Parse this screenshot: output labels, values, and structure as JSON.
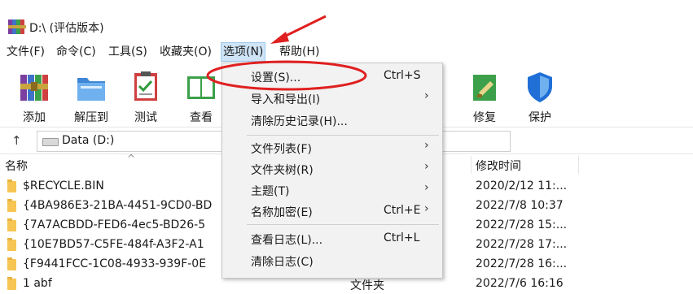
{
  "window": {
    "title": "D:\\ (评估版本)"
  },
  "menubar": {
    "items": [
      "文件(F)",
      "命令(C)",
      "工具(S)",
      "收藏夹(O)",
      "选项(N)",
      "帮助(H)"
    ],
    "active_index": 4
  },
  "toolbar": {
    "buttons": [
      {
        "label": "添加",
        "icon": "add-archive-icon"
      },
      {
        "label": "解压到",
        "icon": "extract-icon"
      },
      {
        "label": "测试",
        "icon": "test-icon"
      },
      {
        "label": "查看",
        "icon": "view-icon"
      },
      {
        "label": "修复",
        "icon": "repair-icon"
      },
      {
        "label": "保护",
        "icon": "protect-shield-icon"
      }
    ]
  },
  "address": {
    "up_glyph": "↑",
    "path": "Data (D:)"
  },
  "columns": {
    "name": "名称",
    "sort_glyph": "^",
    "modified": "修改时间"
  },
  "files": [
    {
      "name": "$RECYCLE.BIN",
      "type": "",
      "modified": "2020/2/12 11:..."
    },
    {
      "name": "{4BA986E3-21BA-4451-9CD0-BD",
      "type": "",
      "modified": "2022/7/8 10:37"
    },
    {
      "name": "{7A7ACBDD-FED6-4ec5-BD26-5",
      "type": "",
      "modified": "2022/7/28 15:..."
    },
    {
      "name": "{10E7BD57-C5FE-484f-A3F2-A1",
      "type": "",
      "modified": "2022/7/28 17:..."
    },
    {
      "name": "{F9441FCC-1C08-4933-939F-0E",
      "type": "",
      "modified": "2022/7/28 16:..."
    },
    {
      "name": "1 abf",
      "type": "文件夹",
      "modified": "2022/7/6 16:16"
    }
  ],
  "options_menu": {
    "groups": [
      [
        {
          "label": "设置(S)...",
          "shortcut": "Ctrl+S",
          "submenu": false
        },
        {
          "label": "导入和导出(I)",
          "shortcut": "",
          "submenu": true
        },
        {
          "label": "清除历史记录(H)...",
          "shortcut": "",
          "submenu": false
        }
      ],
      [
        {
          "label": "文件列表(F)",
          "shortcut": "",
          "submenu": true
        },
        {
          "label": "文件夹树(R)",
          "shortcut": "",
          "submenu": true
        },
        {
          "label": "主题(T)",
          "shortcut": "",
          "submenu": true
        },
        {
          "label": "名称加密(E)",
          "shortcut": "Ctrl+E",
          "submenu": true
        }
      ],
      [
        {
          "label": "查看日志(L)...",
          "shortcut": "Ctrl+L",
          "submenu": false
        },
        {
          "label": "清除日志(C)",
          "shortcut": "",
          "submenu": false
        }
      ]
    ],
    "submenu_arrow": "›"
  },
  "annotation_color": "#e02020"
}
